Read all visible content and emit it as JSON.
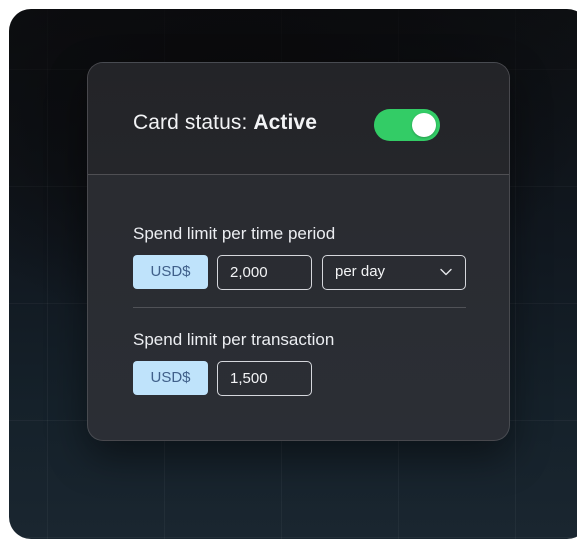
{
  "card": {
    "status_label": "Card status: ",
    "status_value": "Active",
    "toggle_on": true
  },
  "time_period_limit": {
    "title": "Spend limit per time period",
    "currency": "USD$",
    "amount": "2,000",
    "period": "per day"
  },
  "transaction_limit": {
    "title": "Spend limit per transaction",
    "currency": "USD$",
    "amount": "1,500"
  },
  "colors": {
    "toggle_on": "#33cc66",
    "currency_chip_bg": "#bfe3fb",
    "currency_chip_text": "#40608a",
    "card_bg": "#2a2b30"
  },
  "icons": {
    "period_dropdown": "chevron-down-icon"
  }
}
